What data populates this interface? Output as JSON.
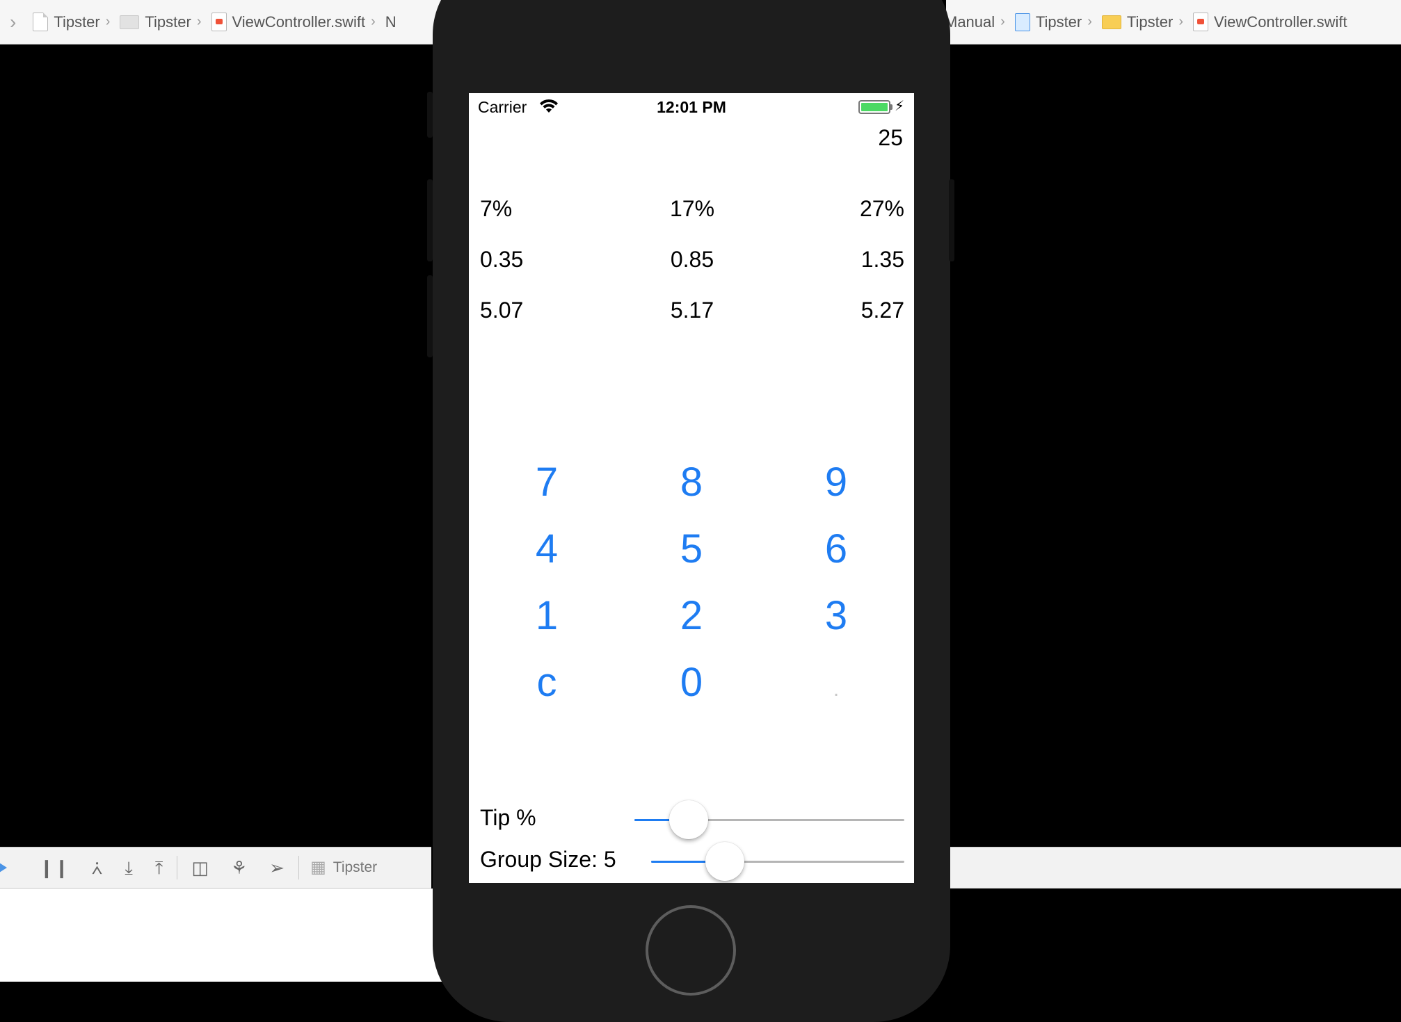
{
  "jumpbar_left": {
    "crumbs": [
      {
        "label": "Tipster",
        "icon": "project-file-icon"
      },
      {
        "label": "Tipster",
        "icon": "folder-icon"
      },
      {
        "label": "ViewController.swift",
        "icon": "swift-file-icon"
      },
      {
        "label": "N",
        "icon": ""
      }
    ]
  },
  "jumpbar_right": {
    "crumbs": [
      {
        "label": "Manual",
        "icon": ""
      },
      {
        "label": "Tipster",
        "icon": "project-icon"
      },
      {
        "label": "Tipster",
        "icon": "folder-icon"
      },
      {
        "label": "ViewController.swift",
        "icon": "swift-file-icon"
      }
    ]
  },
  "debugbar": {
    "scheme_label": "Tipster",
    "icons": [
      "play-icon",
      "pause-icon",
      "step-over-icon",
      "step-into-icon",
      "step-out-icon",
      "view-debugger-icon",
      "memory-graph-icon",
      "location-icon"
    ]
  },
  "status_bar": {
    "carrier": "Carrier",
    "time": "12:01 PM",
    "battery_level": 1.0,
    "battery_color": "#4cd964"
  },
  "bill_amount": "25",
  "tip_rows": {
    "percentages": [
      "7%",
      "17%",
      "27%"
    ],
    "tips": [
      "0.35",
      "0.85",
      "1.35"
    ],
    "totals": [
      "5.07",
      "5.17",
      "5.27"
    ]
  },
  "keypad": {
    "keys": [
      "7",
      "8",
      "9",
      "4",
      "5",
      "6",
      "1",
      "2",
      "3",
      "c",
      "0",
      "."
    ]
  },
  "tip_slider": {
    "label": "Tip %",
    "value_fraction": 0.2
  },
  "group_slider": {
    "label": "Group Size: 5",
    "value_fraction": 0.29
  },
  "accent_color": "#1e7cf2"
}
